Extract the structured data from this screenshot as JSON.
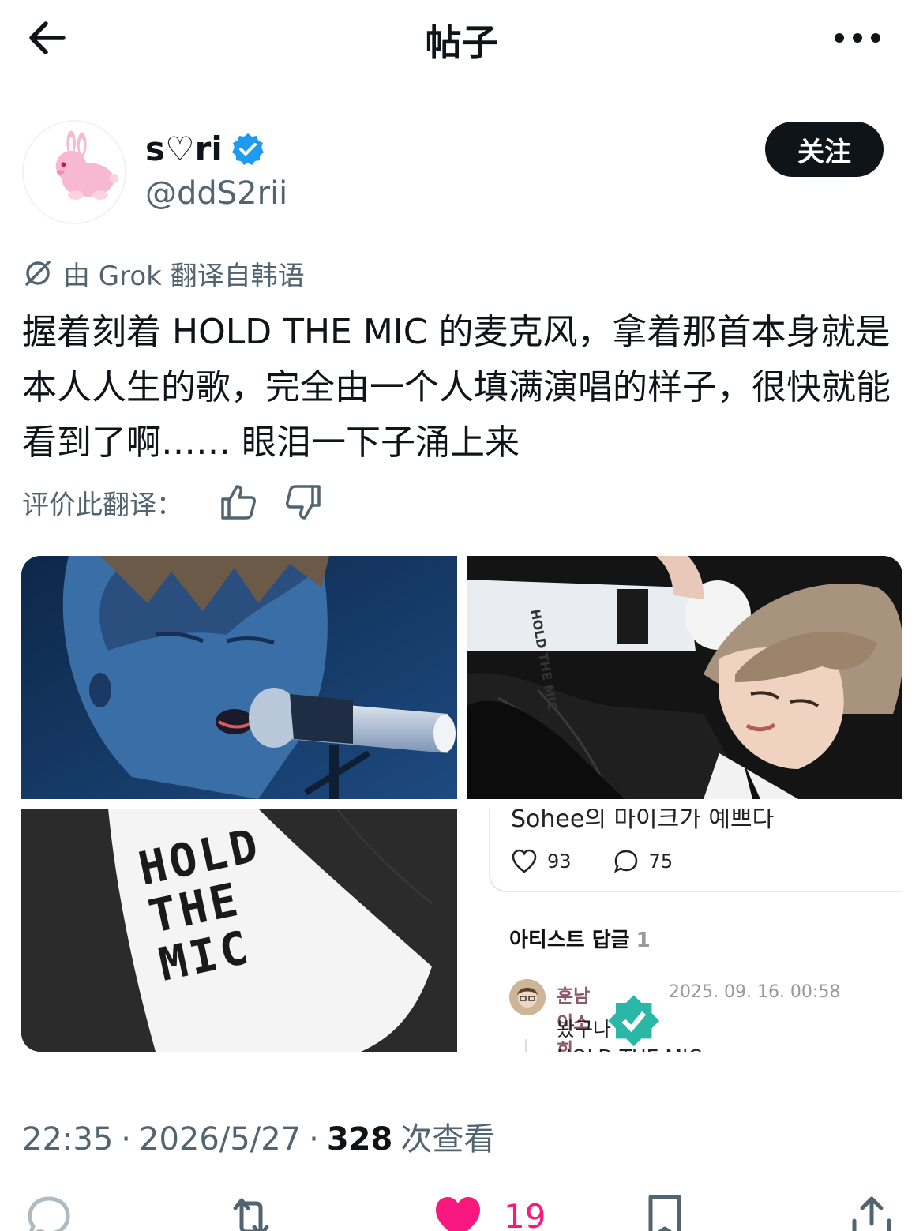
{
  "header": {
    "title": "帖子"
  },
  "author": {
    "name": "s♡ri",
    "handle": "@ddS2rii",
    "follow_label": "关注"
  },
  "translation": {
    "notice": "由 Grok 翻译自韩语",
    "text": "握着刻着 HOLD THE MIC 的麦克风，拿着那首本身就是本人人生的歌，完全由一个人填满演唱的样子，很快就能看到了啊…… 眼泪一下子涌上来",
    "rate_label": "评价此翻译："
  },
  "media": {
    "mic_lettering": "HOLD THE MIC",
    "comment_screenshot": {
      "cut_text": "Sohee의 마이크가 예쁘다",
      "like_count": "93",
      "comment_count": "75",
      "section_title": "아티스트 답글",
      "section_count": "1",
      "reply_author": "훈남이소희",
      "reply_date": "2025. 09. 16. 00:58",
      "reply_text": "봤구나",
      "reply_cut": "HOLD THE MIC"
    }
  },
  "meta": {
    "time": "22:35",
    "separator": "·",
    "date": "2026/5/27",
    "views_count": "328",
    "views_label": "次查看"
  },
  "actions": {
    "like_count": "19"
  },
  "colors": {
    "text": "#0f1419",
    "secondary": "#536471",
    "verified": "#1d9bf0",
    "like": "#f91880",
    "follow_bg": "#0f1419"
  },
  "icons": [
    "back-arrow-icon",
    "more-icon",
    "verified-badge-icon",
    "grok-icon",
    "thumbs-up-icon",
    "thumbs-down-icon",
    "reply-icon",
    "repost-icon",
    "like-icon",
    "bookmark-icon",
    "share-icon"
  ]
}
